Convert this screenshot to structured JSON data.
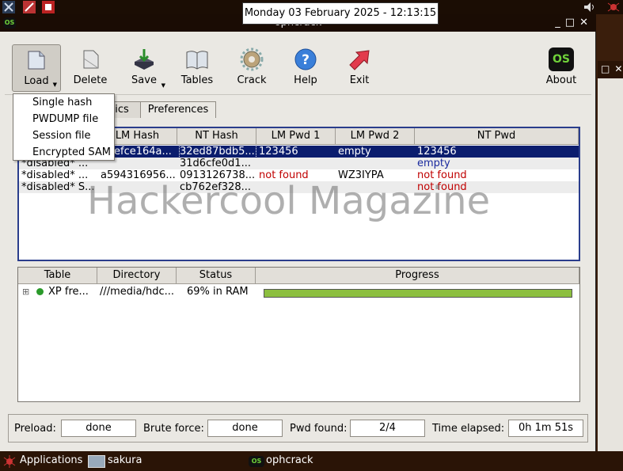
{
  "clock": "Monday 03 February 2025 - 12:13:15",
  "window": {
    "title": "ophcrack",
    "controls": [
      "_",
      "□",
      "✕"
    ]
  },
  "toolbar": {
    "load": "Load",
    "delete": "Delete",
    "save": "Save",
    "tables": "Tables",
    "crack": "Crack",
    "help": "Help",
    "exit": "Exit",
    "about": "About",
    "about_logo": "OS"
  },
  "load_menu": [
    "Single hash",
    "PWDUMP file",
    "Session file",
    "Encrypted SAM"
  ],
  "tabs": {
    "statistics_partial": "ics",
    "preferences": "Preferences"
  },
  "users_table": {
    "headers": [
      "LM Hash",
      "NT Hash",
      "LM Pwd 1",
      "LM Pwd 2",
      "NT Pwd"
    ],
    "rows": [
      {
        "user": "",
        "lm_hash": "efce164a...",
        "nt_hash": "32ed87bdb5...",
        "lm_pwd1": "123456",
        "lm_pwd2": "empty",
        "nt_pwd": "123456"
      },
      {
        "user": "*disabled* ...",
        "lm_hash": "",
        "nt_hash": "31d6cfe0d1...",
        "lm_pwd1": "",
        "lm_pwd2": "",
        "nt_pwd": "empty"
      },
      {
        "user": "*disabled* ...",
        "lm_hash": "a594316956...",
        "nt_hash": "0913126738...",
        "lm_pwd1": "not found",
        "lm_pwd2": "WZ3IYPA",
        "nt_pwd": "not found"
      },
      {
        "user": "*disabled* S...",
        "lm_hash": "",
        "nt_hash": "cb762ef328...",
        "lm_pwd1": "",
        "lm_pwd2": "",
        "nt_pwd": "not found"
      }
    ]
  },
  "watermark": "Hackercool Magazine",
  "tables_panel": {
    "headers": [
      "Table",
      "Directory",
      "Status",
      "Progress"
    ],
    "rows": [
      {
        "expander": "⊞",
        "table": "XP fre...",
        "directory": "///media/hdc...",
        "status": "69% in RAM",
        "progress": 1.0
      }
    ]
  },
  "status": {
    "preload_label": "Preload:",
    "preload": "done",
    "brute_label": "Brute force:",
    "brute": "done",
    "found_label": "Pwd found:",
    "found": "2/4",
    "elapsed_label": "Time elapsed:",
    "elapsed": "0h 1m 51s"
  },
  "taskbar": {
    "applications": "Applications",
    "workspace": "sakura",
    "task": "ophcrack",
    "task_logo": "OS"
  },
  "colors": {
    "accent_green": "#8cbf3f",
    "selection": "#0b1d6e",
    "not_found": "#c00000",
    "logo_green": "#6fd23a"
  }
}
